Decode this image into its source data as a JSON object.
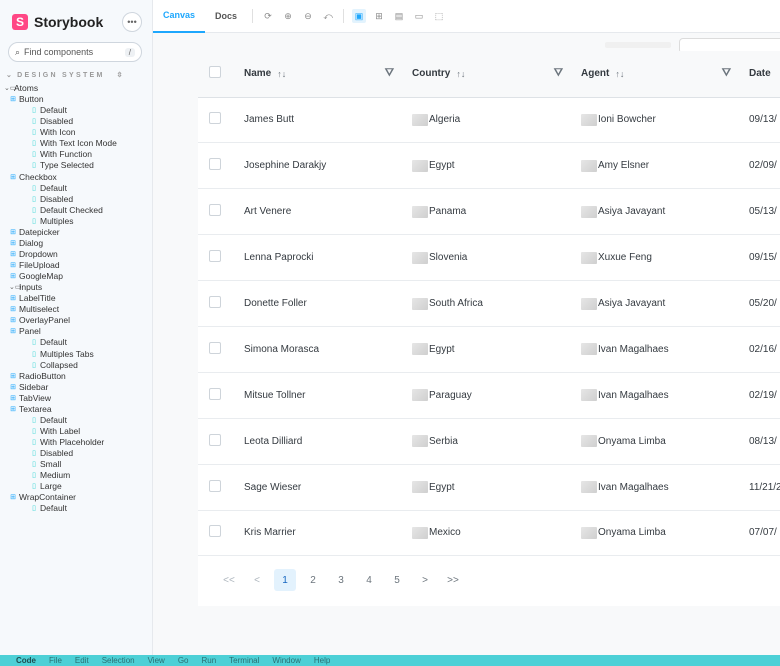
{
  "sidebar": {
    "title": "Storybook",
    "menu_label": "•••",
    "search_placeholder": "Find components",
    "search_shortcut": "/",
    "section_label": "DESIGN SYSTEM",
    "tree": [
      {
        "level": 0,
        "kind": "folder",
        "label": "Atoms"
      },
      {
        "level": 1,
        "kind": "component",
        "label": "Button"
      },
      {
        "level": 2,
        "kind": "story",
        "label": "Default"
      },
      {
        "level": 2,
        "kind": "story",
        "label": "Disabled"
      },
      {
        "level": 2,
        "kind": "story",
        "label": "With Icon"
      },
      {
        "level": 2,
        "kind": "story",
        "label": "With Text Icon Mode"
      },
      {
        "level": 2,
        "kind": "story",
        "label": "With Function"
      },
      {
        "level": 2,
        "kind": "story",
        "label": "Type Selected"
      },
      {
        "level": 1,
        "kind": "component",
        "label": "Checkbox"
      },
      {
        "level": 2,
        "kind": "story",
        "label": "Default"
      },
      {
        "level": 2,
        "kind": "story",
        "label": "Disabled"
      },
      {
        "level": 2,
        "kind": "story",
        "label": "Default Checked"
      },
      {
        "level": 2,
        "kind": "story",
        "label": "Multiples"
      },
      {
        "level": 1,
        "kind": "component",
        "label": "Datepicker"
      },
      {
        "level": 1,
        "kind": "component",
        "label": "Dialog"
      },
      {
        "level": 1,
        "kind": "component",
        "label": "Dropdown"
      },
      {
        "level": 1,
        "kind": "component",
        "label": "FileUpload"
      },
      {
        "level": 1,
        "kind": "component",
        "label": "GoogleMap"
      },
      {
        "level": 1,
        "kind": "folder",
        "label": "Inputs"
      },
      {
        "level": 1,
        "kind": "component",
        "label": "LabelTitle"
      },
      {
        "level": 1,
        "kind": "component",
        "label": "Multiselect"
      },
      {
        "level": 1,
        "kind": "component",
        "label": "OverlayPanel"
      },
      {
        "level": 1,
        "kind": "component",
        "label": "Panel"
      },
      {
        "level": 2,
        "kind": "story",
        "label": "Default"
      },
      {
        "level": 2,
        "kind": "story",
        "label": "Multiples Tabs"
      },
      {
        "level": 2,
        "kind": "story",
        "label": "Collapsed"
      },
      {
        "level": 1,
        "kind": "component",
        "label": "RadioButton"
      },
      {
        "level": 1,
        "kind": "component",
        "label": "Sidebar"
      },
      {
        "level": 1,
        "kind": "component",
        "label": "TabView"
      },
      {
        "level": 1,
        "kind": "component",
        "label": "Textarea"
      },
      {
        "level": 2,
        "kind": "story",
        "label": "Default"
      },
      {
        "level": 2,
        "kind": "story",
        "label": "With Label"
      },
      {
        "level": 2,
        "kind": "story",
        "label": "With Placeholder"
      },
      {
        "level": 2,
        "kind": "story",
        "label": "Disabled"
      },
      {
        "level": 2,
        "kind": "story",
        "label": "Small"
      },
      {
        "level": 2,
        "kind": "story",
        "label": "Medium"
      },
      {
        "level": 2,
        "kind": "story",
        "label": "Large"
      },
      {
        "level": 1,
        "kind": "component",
        "label": "WrapContainer"
      },
      {
        "level": 2,
        "kind": "story",
        "label": "Default"
      }
    ]
  },
  "toolbar": {
    "tabs": [
      "Canvas",
      "Docs"
    ],
    "active_tab": "Canvas"
  },
  "table": {
    "columns": {
      "name": "Name",
      "country": "Country",
      "agent": "Agent",
      "date": "Date"
    },
    "rows": [
      {
        "name": "James Butt",
        "country": "Algeria",
        "agent": "Ioni Bowcher",
        "date": "09/13/"
      },
      {
        "name": "Josephine Darakjy",
        "country": "Egypt",
        "agent": "Amy Elsner",
        "date": "02/09/"
      },
      {
        "name": "Art Venere",
        "country": "Panama",
        "agent": "Asiya Javayant",
        "date": "05/13/"
      },
      {
        "name": "Lenna Paprocki",
        "country": "Slovenia",
        "agent": "Xuxue Feng",
        "date": "09/15/"
      },
      {
        "name": "Donette Foller",
        "country": "South Africa",
        "agent": "Asiya Javayant",
        "date": "05/20/"
      },
      {
        "name": "Simona Morasca",
        "country": "Egypt",
        "agent": "Ivan Magalhaes",
        "date": "02/16/"
      },
      {
        "name": "Mitsue Tollner",
        "country": "Paraguay",
        "agent": "Ivan Magalhaes",
        "date": "02/19/"
      },
      {
        "name": "Leota Dilliard",
        "country": "Serbia",
        "agent": "Onyama Limba",
        "date": "08/13/"
      },
      {
        "name": "Sage Wieser",
        "country": "Egypt",
        "agent": "Ivan Magalhaes",
        "date": "11/21/2"
      },
      {
        "name": "Kris Marrier",
        "country": "Mexico",
        "agent": "Onyama Limba",
        "date": "07/07/"
      }
    ]
  },
  "paginator": {
    "first": "<<",
    "prev": "<",
    "pages": [
      "1",
      "2",
      "3",
      "4",
      "5"
    ],
    "current": "1",
    "next": ">",
    "last": ">>"
  },
  "menubar": {
    "items": [
      "Code",
      "File",
      "Edit",
      "Selection",
      "View",
      "Go",
      "Run",
      "Terminal",
      "Window",
      "Help"
    ]
  }
}
